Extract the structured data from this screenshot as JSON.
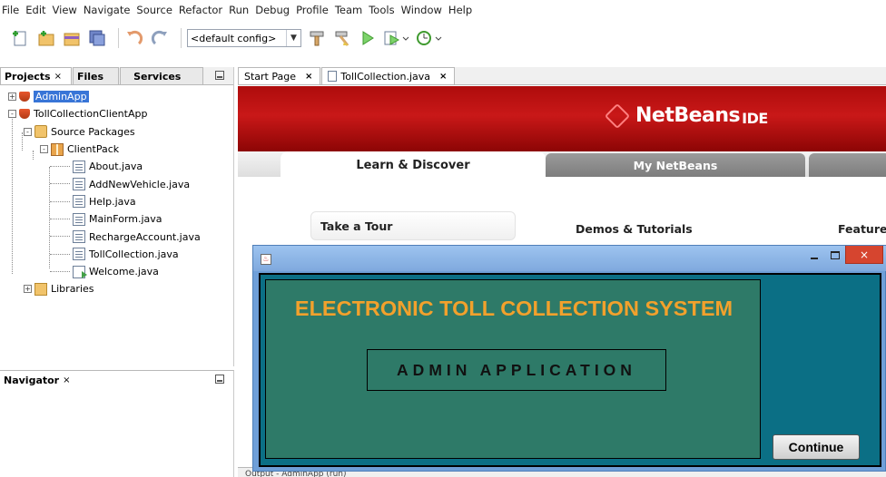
{
  "menu": [
    "File",
    "Edit",
    "View",
    "Navigate",
    "Source",
    "Refactor",
    "Run",
    "Debug",
    "Profile",
    "Team",
    "Tools",
    "Window",
    "Help"
  ],
  "toolbar": {
    "config_value": "<default config>",
    "icons": [
      "new-file-icon",
      "new-project-icon",
      "open-project-icon",
      "save-all-icon",
      "undo-icon",
      "redo-icon",
      "hammer-icon",
      "clean-build-icon",
      "run-icon",
      "debug-icon",
      "profile-icon"
    ]
  },
  "projects_panel": {
    "tabs": [
      {
        "label": "Projects",
        "close": "×"
      },
      {
        "label": "Files"
      },
      {
        "label": "Services"
      }
    ],
    "tree": [
      {
        "label": "AdminApp",
        "icon": "java-project-icon",
        "depth": 0,
        "expander": "+",
        "selected": true
      },
      {
        "label": "TollCollectionClientApp",
        "icon": "java-project-icon",
        "depth": 0,
        "expander": "-"
      },
      {
        "label": "Source Packages",
        "icon": "source-packages-icon",
        "depth": 1,
        "expander": "-"
      },
      {
        "label": "ClientPack",
        "icon": "package-icon",
        "depth": 2,
        "expander": "-"
      },
      {
        "label": "About.java",
        "icon": "java-file-icon",
        "depth": 3
      },
      {
        "label": "AddNewVehicle.java",
        "icon": "java-file-icon",
        "depth": 3
      },
      {
        "label": "Help.java",
        "icon": "java-file-icon",
        "depth": 3
      },
      {
        "label": "MainForm.java",
        "icon": "java-file-icon",
        "depth": 3
      },
      {
        "label": "RechargeAccount.java",
        "icon": "java-file-icon",
        "depth": 3
      },
      {
        "label": "TollCollection.java",
        "icon": "java-file-icon",
        "depth": 3
      },
      {
        "label": "Welcome.java",
        "icon": "java-main-file-icon",
        "depth": 3
      },
      {
        "label": "Libraries",
        "icon": "libraries-icon",
        "depth": 1,
        "expander": "+"
      }
    ]
  },
  "navigator_panel": {
    "label": "Navigator",
    "close": "×"
  },
  "editor_tabs": [
    {
      "label": "Start Page",
      "close": "×"
    },
    {
      "label": "TollCollection.java",
      "close": "×"
    }
  ],
  "start_page": {
    "logo_text": "NetBeans",
    "logo_suffix": "IDE",
    "tabs": [
      "Learn & Discover",
      "My NetBeans"
    ],
    "tour": "Take a Tour",
    "demos": "Demos & Tutorials",
    "featured": "Featured"
  },
  "dialog": {
    "heading": "ELECTRONIC TOLL COLLECTION SYSTEM",
    "subheading": "ADMIN APPLICATION",
    "continue_label": "Continue",
    "close_glyph": "×"
  },
  "output_strip": "Output - AdminApp (run)"
}
